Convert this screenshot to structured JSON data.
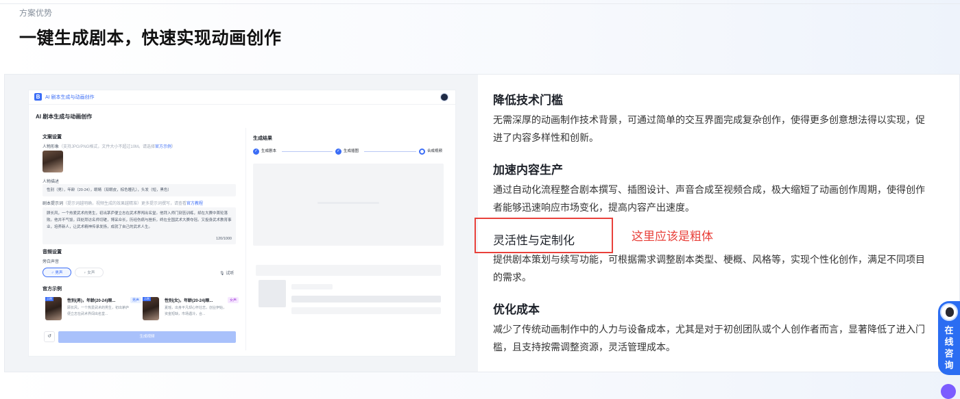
{
  "section": {
    "eyebrow": "方案优势",
    "headline": "一键生成剧本，快速实现动画创作"
  },
  "preview": {
    "app_logo": "B",
    "app_title": "AI 剧本生成与动画创作",
    "page_heading": "AI 剧本生成与动画创作",
    "left": {
      "copy_settings": "文案设置",
      "character_image": "人物形象",
      "character_image_hint": "（支持JPG/PNG格式，文件大小不超过10M。请选择",
      "official_example_link": "官方示例",
      "character_image_hint_end": "）",
      "character_desc_label": "人物描述",
      "character_desc_value": "性别（男），年龄（20-24），眼睛（双眼皮，棕色瞳孔），头发（短，黑色）",
      "script_prompt_label": "剧本提示词",
      "script_prompt_hint": "（提示词越明确，视频生成的效果越精准）更多提示词撰写，请查看",
      "official_tutorial_link": "官方教程",
      "script_prompt_value": "顾长风，一个热爱武术的男生，初出茅庐便立志在武术界闯出名堂。他拜入师门刻苦训练，却在大赛中首轮落败。他并不气馁，四处拜访名师切磋，博采众长，历经伤病与挫折，终在全国武术大赛夺冠。又投身武术教育事业，培养新人，让武术精神传承发扬，成就了自己的武术人生。",
      "char_count": "120/1000",
      "audio_settings": "音频设置",
      "narration_voice": "旁白声音",
      "male_voice": "男声",
      "female_voice": "女声",
      "trial_listen": "试听",
      "official_examples": "官方示例",
      "examples": [
        {
          "tag": "示例",
          "title": "性别(男)，年龄(20-24)眼...",
          "desc": "顾长风，一个热爱武术的男生，初出茅庐便立志在武术界闯出名堂...",
          "badge": "男声"
        },
        {
          "tag": "示例",
          "title": "性别(女)，年龄(20-24)眼...",
          "desc": "夏瑶，出身平凡却心怀壮志，创业伊始，资金短缺，市场遇冷，合...",
          "badge": "女声"
        }
      ],
      "generate_button": "生成视频"
    },
    "right": {
      "result_title": "生成结果",
      "steps": [
        "生成剧本",
        "生成插图",
        "合成视频"
      ]
    }
  },
  "features": [
    {
      "title": "降低技术门槛",
      "desc": "无需深厚的动画制作技术背景，可通过简单的交互界面完成复杂创作，使得更多创意想法得以实现，促进了内容多样性和创新。"
    },
    {
      "title": "加速内容生产",
      "desc": "通过自动化流程整合剧本撰写、插图设计、声音合成至视频合成，极大缩短了动画创作周期，使得创作者能够迅速响应市场变化，提高内容产出速度。"
    },
    {
      "title": "灵活性与定制化",
      "desc": "提供剧本策划与续写功能，可根据需求调整剧本类型、梗概、风格等，实现个性化创作，满足不同项目的需求。"
    },
    {
      "title": "优化成本",
      "desc": "减少了传统动画制作中的人力与设备成本，尤其是对于初创团队或个人创作者而言，显著降低了进入门槛，且支持按需调整资源，灵活管理成本。"
    }
  ],
  "annotation": {
    "note": "这里应该是粗体",
    "color": "#e8403a"
  },
  "consult": {
    "label": "在线咨询"
  },
  "colors": {
    "accent": "#3b6df6",
    "consult": "#2b6df2"
  }
}
